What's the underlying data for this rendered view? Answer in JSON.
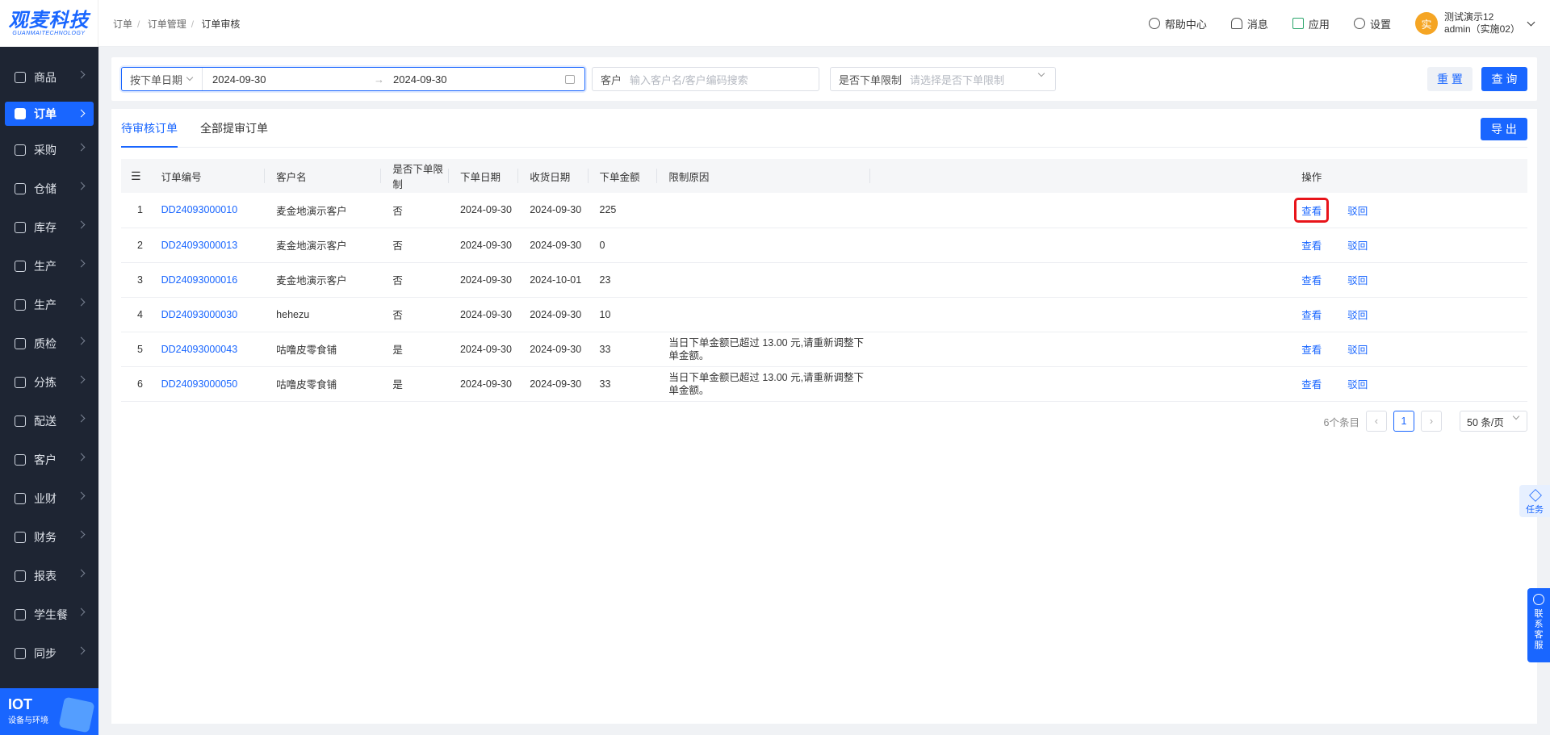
{
  "logo": {
    "main": "观麦科技",
    "sub": "GUANMAITECHNOLOGY"
  },
  "sidebar": {
    "items": [
      {
        "label": "商品",
        "active": false
      },
      {
        "label": "订单",
        "active": true
      },
      {
        "label": "采购",
        "active": false
      },
      {
        "label": "仓储",
        "active": false
      },
      {
        "label": "库存",
        "active": false
      },
      {
        "label": "生产",
        "active": false
      },
      {
        "label": "生产",
        "active": false
      },
      {
        "label": "质检",
        "active": false
      },
      {
        "label": "分拣",
        "active": false
      },
      {
        "label": "配送",
        "active": false
      },
      {
        "label": "客户",
        "active": false
      },
      {
        "label": "业财",
        "active": false
      },
      {
        "label": "财务",
        "active": false
      },
      {
        "label": "报表",
        "active": false
      },
      {
        "label": "学生餐",
        "active": false
      },
      {
        "label": "同步",
        "active": false
      }
    ],
    "iot": {
      "title": "IOT",
      "subtitle": "设备与环境"
    }
  },
  "header": {
    "breadcrumb": [
      "订单",
      "订单管理",
      "订单审核"
    ],
    "actions": {
      "help": "帮助中心",
      "messages": "消息",
      "apps": "应用",
      "settings": "设置"
    },
    "user": {
      "avatar": "实",
      "name": "测试演示12",
      "account": "admin（实施02）"
    }
  },
  "filters": {
    "date_type": "按下单日期",
    "date_start": "2024-09-30",
    "date_arrow": "→",
    "date_end": "2024-09-30",
    "customer_label": "客户",
    "customer_placeholder": "输入客户名/客户编码搜索",
    "limit_label": "是否下单限制",
    "limit_placeholder": "请选择是否下单限制",
    "reset": "重 置",
    "query": "查 询"
  },
  "tabs": [
    {
      "label": "待审核订单",
      "active": true
    },
    {
      "label": "全部提审订单",
      "active": false
    }
  ],
  "export": "导 出",
  "table": {
    "columns": [
      "订单编号",
      "客户名",
      "是否下单限制",
      "下单日期",
      "收货日期",
      "下单金额",
      "限制原因",
      "操作"
    ],
    "rows": [
      {
        "no": "1",
        "order": "DD24093000010",
        "customer": "麦金地演示客户",
        "limited": "否",
        "order_date": "2024-09-30",
        "receive_date": "2024-09-30",
        "amount": "225",
        "reason": ""
      },
      {
        "no": "2",
        "order": "DD24093000013",
        "customer": "麦金地演示客户",
        "limited": "否",
        "order_date": "2024-09-30",
        "receive_date": "2024-09-30",
        "amount": "0",
        "reason": ""
      },
      {
        "no": "3",
        "order": "DD24093000016",
        "customer": "麦金地演示客户",
        "limited": "否",
        "order_date": "2024-09-30",
        "receive_date": "2024-10-01",
        "amount": "23",
        "reason": ""
      },
      {
        "no": "4",
        "order": "DD24093000030",
        "customer": "hehezu",
        "limited": "否",
        "order_date": "2024-09-30",
        "receive_date": "2024-09-30",
        "amount": "10",
        "reason": ""
      },
      {
        "no": "5",
        "order": "DD24093000043",
        "customer": "咕噜皮零食铺",
        "limited": "是",
        "order_date": "2024-09-30",
        "receive_date": "2024-09-30",
        "amount": "33",
        "reason": "当日下单金额已超过 13.00 元,请重新调整下单金额。"
      },
      {
        "no": "6",
        "order": "DD24093000050",
        "customer": "咕噜皮零食铺",
        "limited": "是",
        "order_date": "2024-09-30",
        "receive_date": "2024-09-30",
        "amount": "33",
        "reason": "当日下单金额已超过 13.00 元,请重新调整下单金额。"
      }
    ],
    "view": "查看",
    "reject": "驳回"
  },
  "pager": {
    "total": "6个条目",
    "current": "1",
    "size": "50 条/页"
  },
  "float": {
    "task": "任务",
    "cs": "联系客服"
  },
  "colors": {
    "accent": "#1966ff",
    "sidebar": "#1e2533",
    "highlight": "#e8141a"
  }
}
